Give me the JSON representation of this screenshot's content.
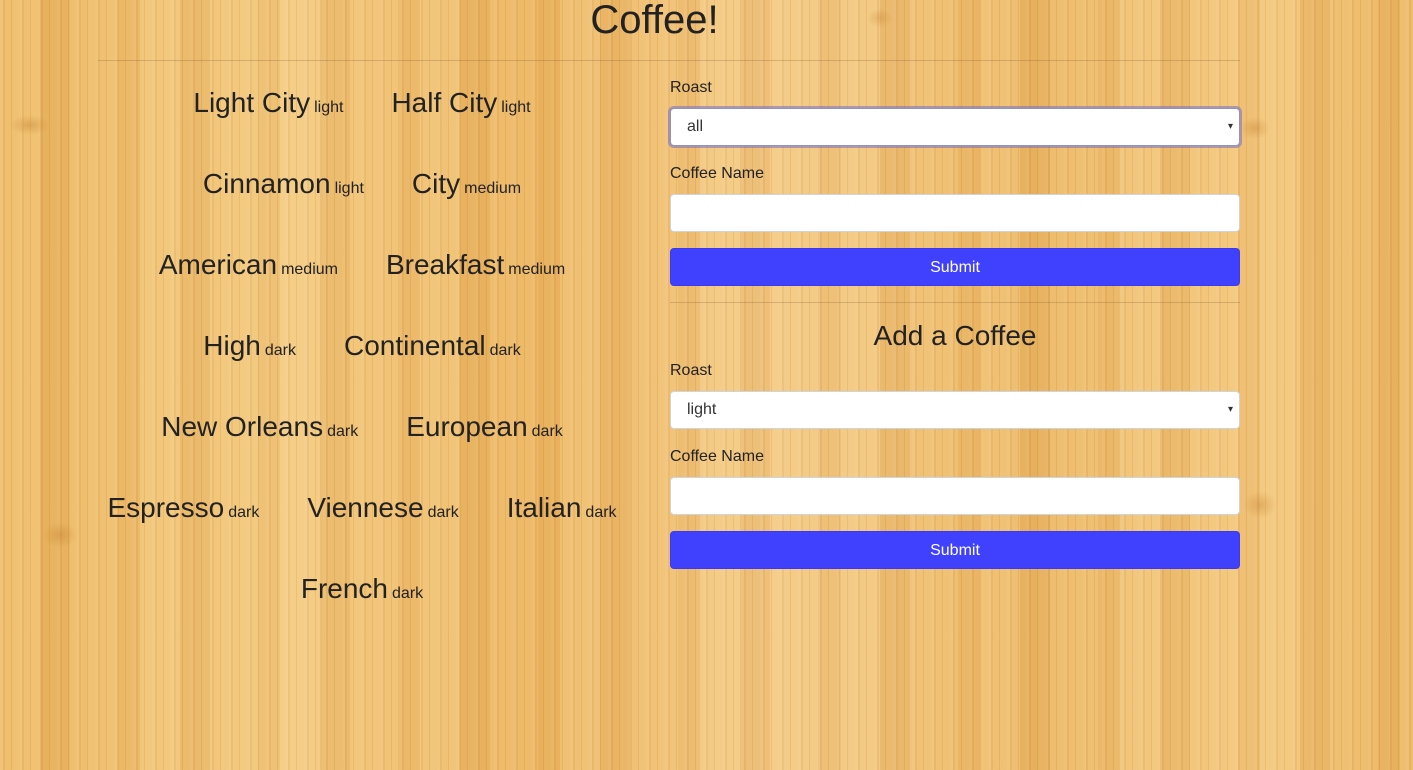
{
  "page": {
    "title": "Coffee!"
  },
  "coffees": {
    "rows": [
      [
        {
          "name": "Light City",
          "roast": "light"
        },
        {
          "name": "Half City",
          "roast": "light"
        }
      ],
      [
        {
          "name": "Cinnamon",
          "roast": "light"
        },
        {
          "name": "City",
          "roast": "medium"
        }
      ],
      [
        {
          "name": "American",
          "roast": "medium"
        },
        {
          "name": "Breakfast",
          "roast": "medium"
        }
      ],
      [
        {
          "name": "High",
          "roast": "dark"
        },
        {
          "name": "Continental",
          "roast": "dark"
        }
      ],
      [
        {
          "name": "New Orleans",
          "roast": "dark"
        },
        {
          "name": "European",
          "roast": "dark"
        }
      ],
      [
        {
          "name": "Espresso",
          "roast": "dark"
        },
        {
          "name": "Viennese",
          "roast": "dark"
        },
        {
          "name": "Italian",
          "roast": "dark"
        }
      ],
      [
        {
          "name": "French",
          "roast": "dark"
        }
      ]
    ]
  },
  "filter_form": {
    "roast_label": "Roast",
    "roast_value": "all",
    "name_label": "Coffee Name",
    "name_value": "",
    "submit_label": "Submit"
  },
  "add_form": {
    "heading": "Add a Coffee",
    "roast_label": "Roast",
    "roast_value": "light",
    "name_label": "Coffee Name",
    "name_value": "",
    "submit_label": "Submit"
  },
  "colors": {
    "button": "#4040ff",
    "background": "#eeba60"
  }
}
